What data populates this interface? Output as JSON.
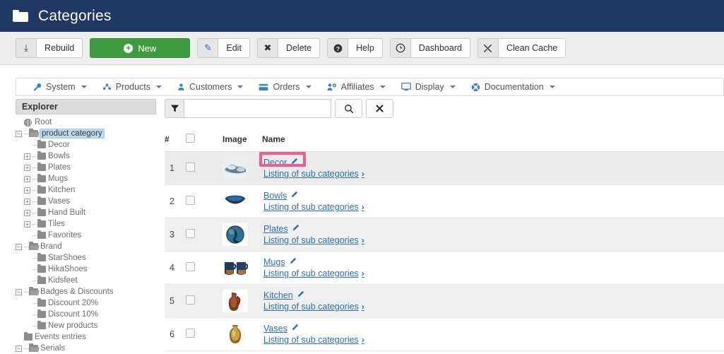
{
  "header": {
    "title": "Categories",
    "icon": "folder-icon",
    "bg": "#1f3864"
  },
  "toolbar": {
    "buttons": [
      {
        "label": "Rebuild",
        "icon": "download-icon",
        "glyph": "⤓"
      },
      {
        "label": "Edit",
        "icon": "edit-square-icon",
        "glyph": "✎"
      },
      {
        "label": "Delete",
        "icon": "close-x-icon",
        "glyph": "✖"
      },
      {
        "label": "Help",
        "icon": "question-circle-icon",
        "glyph": "?"
      },
      {
        "label": "Dashboard",
        "icon": "clock-icon",
        "glyph": "◴"
      },
      {
        "label": "Clean Cache",
        "icon": "broom-icon",
        "glyph": "✗"
      }
    ],
    "new_button": {
      "label": "New",
      "icon": "plus-circle-icon",
      "color": "#3d9c41"
    }
  },
  "menubar": {
    "items": [
      {
        "label": "System",
        "icon": "wrench-icon",
        "glyph": "🔧"
      },
      {
        "label": "Products",
        "icon": "share-nodes-icon",
        "glyph": "☸"
      },
      {
        "label": "Customers",
        "icon": "user-icon",
        "glyph": "👤"
      },
      {
        "label": "Orders",
        "icon": "credit-card-icon",
        "glyph": "▤"
      },
      {
        "label": "Affiliates",
        "icon": "users-gear-icon",
        "glyph": "⚙"
      },
      {
        "label": "Display",
        "icon": "monitor-icon",
        "glyph": "▭"
      },
      {
        "label": "Documentation",
        "icon": "lifebuoy-icon",
        "glyph": "☉"
      }
    ]
  },
  "sidebar": {
    "title": "Explorer",
    "selected": "product category",
    "nodes": [
      {
        "label": "Root",
        "depth": 0,
        "icon": "globe-icon",
        "toggle": "none"
      },
      {
        "label": "product category",
        "depth": 0,
        "icon": "folder-open-icon",
        "toggle": "minus",
        "selected": true
      },
      {
        "label": "Decor",
        "depth": 1,
        "icon": "folder-icon",
        "toggle": "none"
      },
      {
        "label": "Bowls",
        "depth": 1,
        "icon": "folder-icon",
        "toggle": "plus"
      },
      {
        "label": "Plates",
        "depth": 1,
        "icon": "folder-icon",
        "toggle": "plus"
      },
      {
        "label": "Mugs",
        "depth": 1,
        "icon": "folder-icon",
        "toggle": "plus"
      },
      {
        "label": "Kitchen",
        "depth": 1,
        "icon": "folder-icon",
        "toggle": "plus"
      },
      {
        "label": "Vases",
        "depth": 1,
        "icon": "folder-icon",
        "toggle": "plus"
      },
      {
        "label": "Hand Built",
        "depth": 1,
        "icon": "folder-icon",
        "toggle": "plus"
      },
      {
        "label": "Tiles",
        "depth": 1,
        "icon": "folder-icon",
        "toggle": "plus"
      },
      {
        "label": "Favorites",
        "depth": 1,
        "icon": "folder-icon",
        "toggle": "none"
      },
      {
        "label": "Brand",
        "depth": 0,
        "icon": "folder-open-icon",
        "toggle": "minus"
      },
      {
        "label": "StarShoes",
        "depth": 1,
        "icon": "folder-icon",
        "toggle": "none"
      },
      {
        "label": "HikaShoes",
        "depth": 1,
        "icon": "folder-icon",
        "toggle": "none"
      },
      {
        "label": "Kidsfeet",
        "depth": 1,
        "icon": "folder-icon",
        "toggle": "none"
      },
      {
        "label": "Badges & Discounts",
        "depth": 0,
        "icon": "folder-open-icon",
        "toggle": "minus"
      },
      {
        "label": "Discount 20%",
        "depth": 1,
        "icon": "folder-icon",
        "toggle": "none"
      },
      {
        "label": "Discount 10%",
        "depth": 1,
        "icon": "folder-icon",
        "toggle": "none"
      },
      {
        "label": "New products",
        "depth": 1,
        "icon": "folder-icon",
        "toggle": "none"
      },
      {
        "label": "Events entries",
        "depth": 0,
        "icon": "folder-icon",
        "toggle": "none"
      },
      {
        "label": "Serials",
        "depth": 0,
        "icon": "folder-open-icon",
        "toggle": "minus"
      }
    ]
  },
  "filter": {
    "icon": "funnel-icon",
    "value": "",
    "placeholder": "",
    "search_icon": "magnifier-icon",
    "clear_icon": "close-x-icon"
  },
  "table": {
    "columns": {
      "num": "#",
      "check": "",
      "image": "Image",
      "name": "Name"
    },
    "sub_label": "Listing of sub categories",
    "rows": [
      {
        "num": "1",
        "name": "Decor",
        "thumb": "decor-thumb",
        "highlighted": true
      },
      {
        "num": "2",
        "name": "Bowls",
        "thumb": "bowls-thumb",
        "highlighted": false
      },
      {
        "num": "3",
        "name": "Plates",
        "thumb": "plates-thumb",
        "highlighted": false
      },
      {
        "num": "4",
        "name": "Mugs",
        "thumb": "mugs-thumb",
        "highlighted": false
      },
      {
        "num": "5",
        "name": "Kitchen",
        "thumb": "kitchen-thumb",
        "highlighted": false
      },
      {
        "num": "6",
        "name": "Vases",
        "thumb": "vases-thumb",
        "highlighted": false
      }
    ]
  },
  "colors": {
    "header_bg": "#1f3864",
    "new_green": "#3d9c41",
    "link_blue": "#2f6fb0",
    "highlight_pink": "#ef5a90",
    "tree_selection": "#bcd8f2"
  }
}
